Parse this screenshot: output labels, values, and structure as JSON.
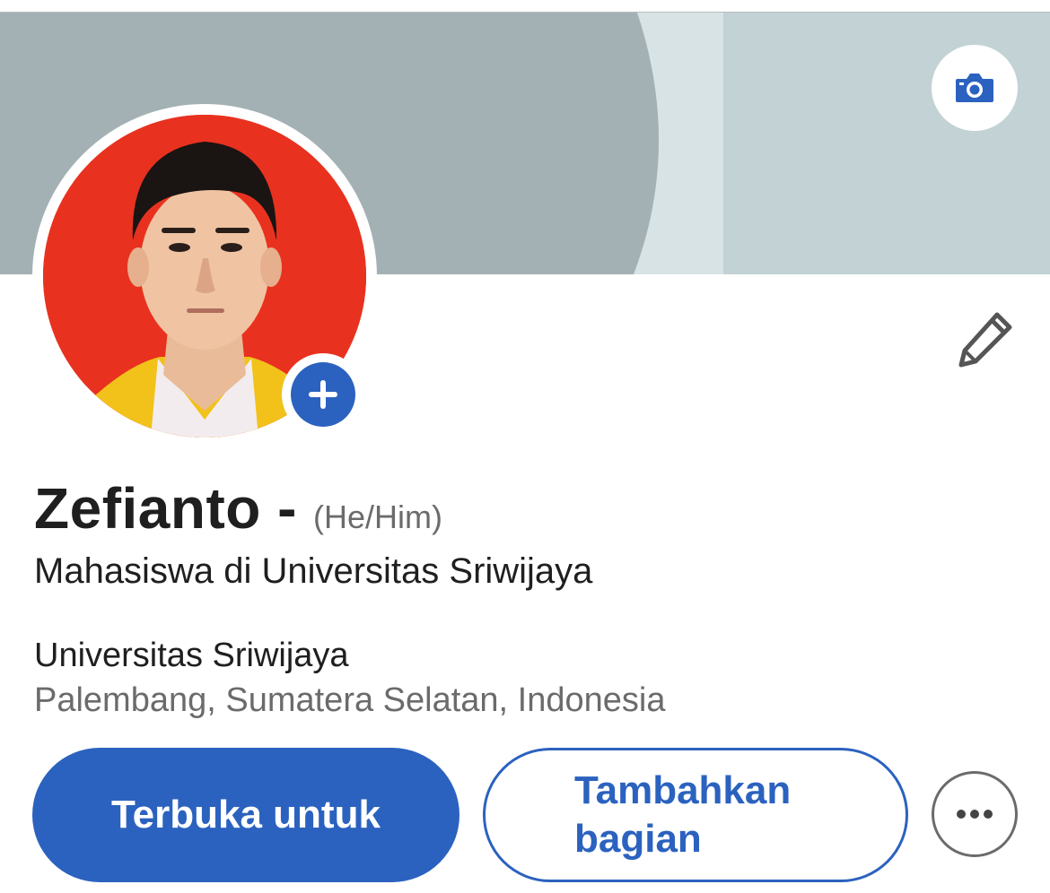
{
  "profile": {
    "name": "Zefianto -",
    "pronouns": "(He/Him)",
    "headline": "Mahasiswa di Universitas Sriwijaya",
    "organization": "Universitas Sriwijaya",
    "location": "Palembang, Sumatera Selatan, Indonesia"
  },
  "actions": {
    "primary_label": "Terbuka untuk",
    "secondary_label": "Tambahkan bagian"
  },
  "icons": {
    "camera": "camera-icon",
    "add_photo": "plus-icon",
    "edit": "pencil-icon",
    "more": "ellipsis-icon"
  },
  "colors": {
    "accent": "#2b62bf",
    "banner_dark": "#a4b1b4",
    "banner_light": "#c2d2d5",
    "avatar_background": "#e8321f"
  }
}
